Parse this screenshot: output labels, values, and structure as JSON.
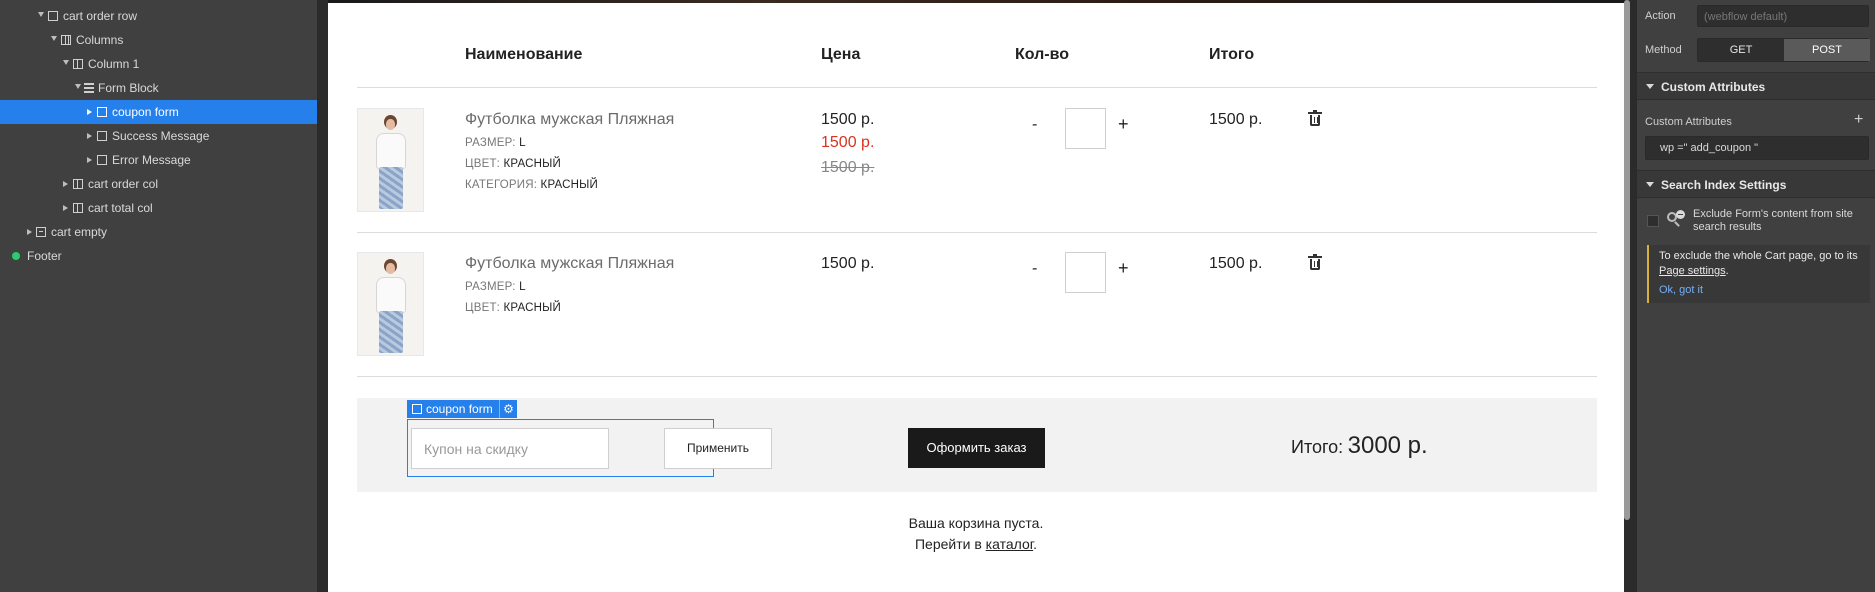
{
  "navigator": {
    "items": [
      {
        "label": "cart order row",
        "icon": "box-icon",
        "expanded": true
      },
      {
        "label": "Columns",
        "icon": "columns-icon",
        "expanded": true
      },
      {
        "label": "Column 1",
        "icon": "column-icon",
        "expanded": true
      },
      {
        "label": "Form Block",
        "icon": "form-icon",
        "expanded": true
      },
      {
        "label": "coupon form",
        "icon": "box-icon",
        "expanded": false,
        "selected": true
      },
      {
        "label": "Success Message",
        "icon": "box-icon",
        "expanded": false
      },
      {
        "label": "Error Message",
        "icon": "box-icon",
        "expanded": false
      },
      {
        "label": "cart order col",
        "icon": "column-icon",
        "expanded": false
      },
      {
        "label": "cart total col",
        "icon": "column-icon",
        "expanded": false
      },
      {
        "label": "cart empty",
        "icon": "tabs-icon",
        "expanded": false
      },
      {
        "label": "Footer",
        "icon": "symbol-icon"
      }
    ]
  },
  "cart": {
    "headers": {
      "name": "Наименование",
      "price": "Цена",
      "qty": "Кол-во",
      "total": "Итого"
    },
    "rows": [
      {
        "name": "Футболка мужская Пляжная",
        "size_label": "РАЗМЕР:",
        "size": "L",
        "color_label": "ЦВЕТ:",
        "color": "КРАСНЫЙ",
        "category_label": "КАТЕГОРИЯ:",
        "category": "КРАСНЫЙ",
        "price": "1500 р.",
        "price_sale": "1500 р.",
        "price_old": "1500 р.",
        "minus": "-",
        "plus": "+",
        "total": "1500 р."
      },
      {
        "name": "Футболка мужская Пляжная",
        "size_label": "РАЗМЕР:",
        "size": "L",
        "color_label": "ЦВЕТ:",
        "color": "КРАСНЫЙ",
        "price": "1500 р.",
        "minus": "-",
        "plus": "+",
        "total": "1500 р."
      }
    ],
    "coupon": {
      "tag": "coupon form",
      "gear": "⚙",
      "placeholder": "Купон на скидку",
      "apply": "Применить"
    },
    "checkout": "Оформить заказ",
    "grand_label": "Итого:",
    "grand_value": "3000 р.",
    "empty_line1": "Ваша корзина пуста.",
    "empty_line2_pre": "Перейти в ",
    "empty_link": "каталог",
    "empty_line2_post": "."
  },
  "settings": {
    "action_label": "Action",
    "action_placeholder": "(webflow default)",
    "method_label": "Method",
    "method_get": "GET",
    "method_post": "POST",
    "method_selected": "POST",
    "custom_attributes_title": "Custom Attributes",
    "custom_attributes_label": "Custom Attributes",
    "add": "+",
    "attribute": "wp =\" add_coupon \"",
    "search_index_title": "Search Index Settings",
    "exclude_text": "Exclude Form's content from site search results",
    "hint_pre": "To exclude the whole Cart page, go to its ",
    "hint_link": "Page settings",
    "hint_post": ".",
    "hint_ok": "Ok, got it"
  },
  "colors": {
    "selection": "#2680eb",
    "accent_red": "#d9331f",
    "hint_border": "#d9b03a"
  }
}
